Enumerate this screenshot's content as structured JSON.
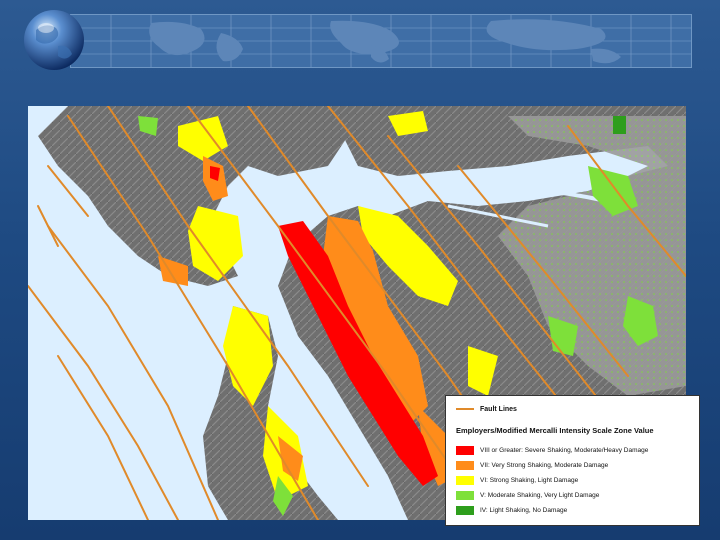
{
  "legend": {
    "fault_label": "Fault Lines",
    "title": "Employers/Modified Mercalli Intensity Scale Zone Value",
    "entries": [
      {
        "label": "VIII or Greater: Severe Shaking, Moderate/Heavy Damage",
        "color": "#ff0000"
      },
      {
        "label": "VII: Very Strong Shaking, Moderate Damage",
        "color": "#ff8c1a"
      },
      {
        "label": "VI: Strong Shaking, Light Damage",
        "color": "#ffff00"
      },
      {
        "label": "V: Moderate Shaking, Very Light Damage",
        "color": "#7ee03a"
      },
      {
        "label": "IV: Light Shaking, No Damage",
        "color": "#2e9e1c"
      }
    ]
  },
  "colors": {
    "fault": "#e08a2a",
    "water": "#dcefff",
    "land": "#6f6f6f",
    "background": "#1e4a82"
  },
  "icons": {
    "banner_globe": "globe-icon"
  }
}
